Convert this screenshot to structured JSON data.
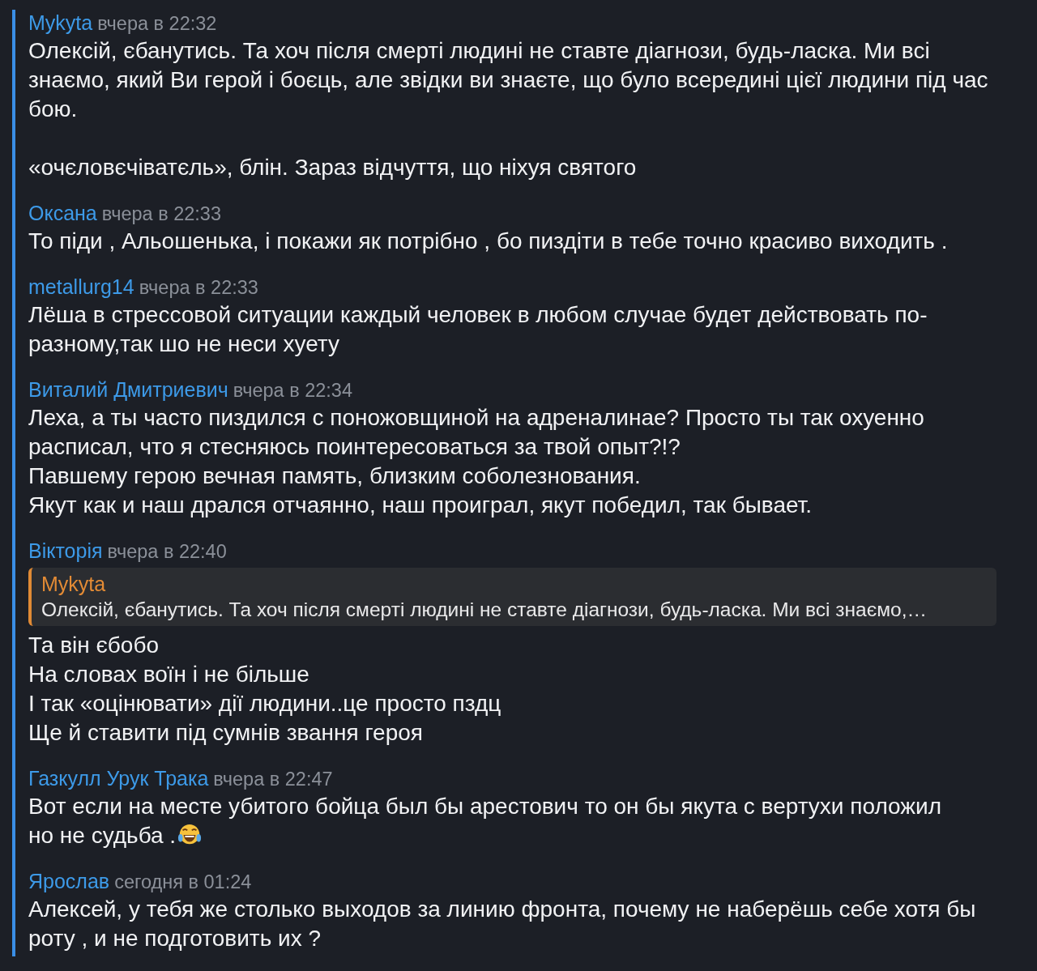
{
  "messages": [
    {
      "author": "Mykyta",
      "time": "вчера в 22:32",
      "text": "Олексій, єбанутись. Та хоч після смерті людині не ставте діагнози, будь-ласка. Ми всі знаємо, який Ви герой і боєць, але звідки ви знаєте, що було всередині цієї людини під час бою.\n\n«очєловєчіватєль», блін. Зараз відчуття, що ніхуя святого"
    },
    {
      "author": "Оксана",
      "time": "вчера в 22:33",
      "text": "То піди , Альошенька, і покажи як потрібно , бо пиздіти в тебе точно красиво виходить ."
    },
    {
      "author": "metallurg14",
      "time": "вчера в 22:33",
      "text": "Лёша в стрессовой ситуации каждый человек в любом случае будет действовать по-разному,так шо не неси хуету"
    },
    {
      "author": "Виталий Дмитриевич",
      "time": "вчера в 22:34",
      "text": "Леха, а ты часто пиздился с поножовщиной на адреналинае? Просто ты так охуенно расписал, что я стесняюсь поинтересоваться за твой опыт?!?\nПавшему герою вечная память, близким соболезнования.\nЯкут как и наш дрался отчаянно, наш проиграл, якут победил, так бывает."
    },
    {
      "author": "Вікторія",
      "time": "вчера в 22:40",
      "reply": {
        "author": "Mykyta",
        "text": "Олексій, єбанутись. Та хоч після смерті людині не ставте діагнози, будь-ласка. Ми всі знаємо,…"
      },
      "text": "Та він єбобо\nНа словах воїн і не більше\nІ так «оцінювати» дії людини..це просто пздц\nЩе й ставити під сумнів звання героя"
    },
    {
      "author": "Газкулл Урук Трака",
      "time": "вчера в 22:47",
      "text": "Вот если на месте убитого бойца был бы арестович то он бы якута с вертухи положил\nно не судьба .",
      "emoji": true
    },
    {
      "author": "Ярослав",
      "time": "сегодня в 01:24",
      "text": "Алексей, у тебя же столько выходов за линию фронта, почему не наберёшь себе хотя бы роту , и не подготовить их ?"
    }
  ]
}
